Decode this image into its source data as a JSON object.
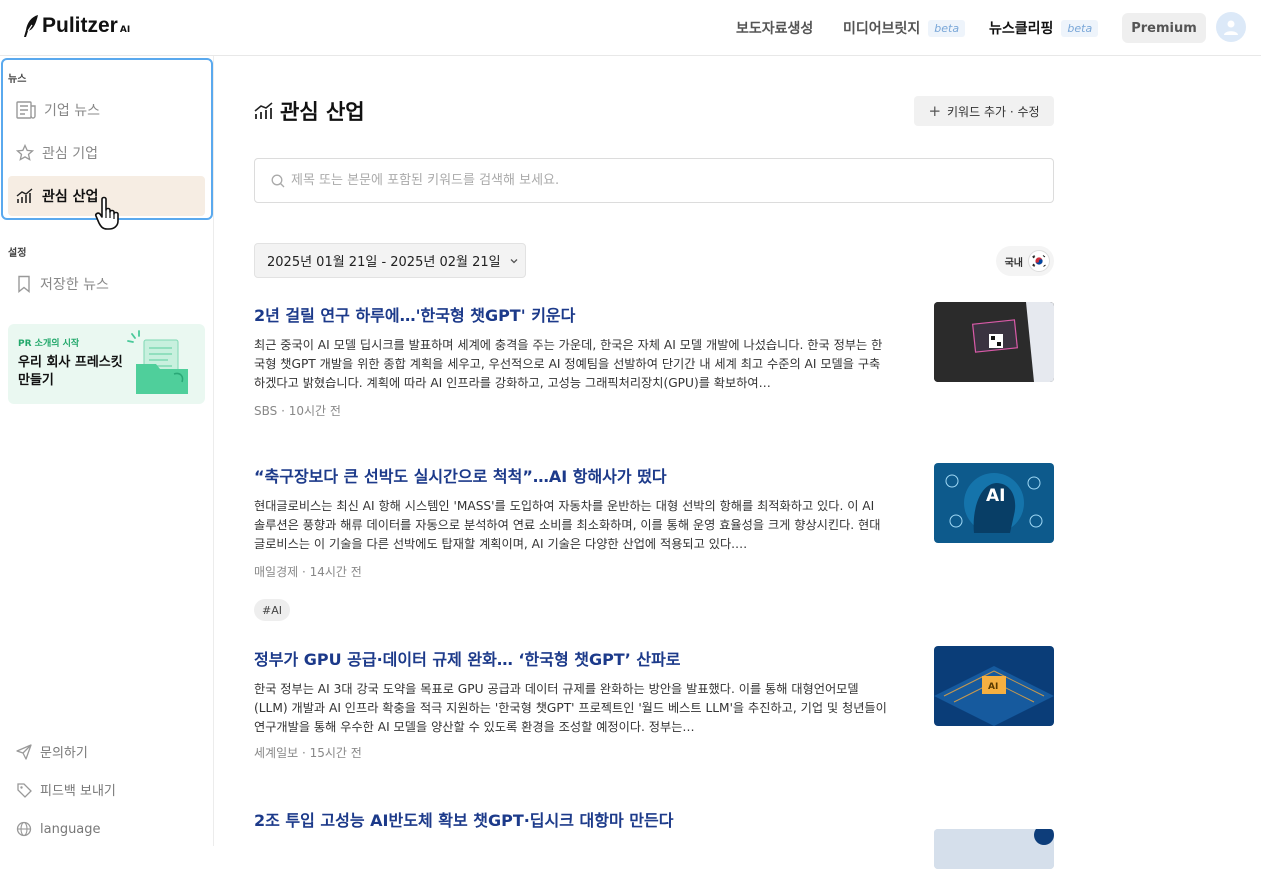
{
  "header": {
    "logo_name": "Pulitzer",
    "logo_suffix": "AI",
    "nav": [
      {
        "label": "보도자료생성",
        "badge": ""
      },
      {
        "label": "미디어브릿지",
        "badge": "beta"
      },
      {
        "label": "뉴스클리핑",
        "badge": "beta"
      }
    ],
    "premium_label": "Premium"
  },
  "sidebar": {
    "news_section": "뉴스",
    "items": [
      {
        "label": "기업 뉴스"
      },
      {
        "label": "관심 기업"
      },
      {
        "label": "관심 산업"
      }
    ],
    "settings_section": "설정",
    "saved_news": "저장한 뉴스",
    "promo": {
      "small": "PR 소개의 시작",
      "title": "우리 회사 프레스킷 만들기"
    },
    "bottom": [
      {
        "label": "문의하기"
      },
      {
        "label": "피드백 보내기"
      },
      {
        "label": "language"
      }
    ]
  },
  "main": {
    "title": "관심 산업",
    "keyword_button": "키워드 추가 · 수정",
    "search_placeholder": "제목 또는 본문에 포함된 키워드를 검색해 보세요.",
    "date_range": "2025년 01월 21일 - 2025년 02월 21일",
    "region": "국내",
    "articles": [
      {
        "title": "2년 걸릴 연구 하루에…'한국형 챗GPT' 키운다",
        "body": "최근 중국이 AI 모델 딥시크를 발표하며 세계에 충격을 주는 가운데, 한국은 자체 AI 모델 개발에 나섰습니다. 한국 정부는 한국형 챗GPT 개발을 위한 종합 계획을 세우고, 우선적으로 AI 정예팀을 선발하여 단기간 내 세계 최고 수준의 AI 모델을 구축하겠다고 밝혔습니다. 계획에 따라 AI 인프라를 강화하고, 고성능 그래픽처리장치(GPU)를 확보하여…",
        "meta": "SBS · 10시간 전",
        "tag": ""
      },
      {
        "title": "“축구장보다 큰 선박도 실시간으로 척척”…AI 항해사가 떴다",
        "body": "현대글로비스는 최신 AI 항해 시스템인 'MASS'를 도입하여 자동차를 운반하는 대형 선박의 항해를 최적화하고 있다. 이 AI 솔루션은 풍향과 해류 데이터를 자동으로 분석하여 연료 소비를 최소화하며, 이를 통해 운영 효율성을 크게 향상시킨다. 현대글로비스는 이 기술을 다른 선박에도 탑재할 계획이며, AI 기술은 다양한 산업에 적용되고 있다.…",
        "meta": "매일경제 · 14시간 전",
        "tag": "#AI"
      },
      {
        "title": "정부가 GPU 공급·데이터 규제 완화… ‘한국형 챗GPT’ 산파로",
        "body": "한국 정부는 AI 3대 강국 도약을 목표로 GPU 공급과 데이터 규제를 완화하는 방안을 발표했다. 이를 통해 대형언어모델(LLM) 개발과 AI 인프라 확충을 적극 지원하는 '한국형 챗GPT' 프로젝트인 '월드 베스트 LLM'을 추진하고, 기업 및 청년들이 연구개발을 통해 우수한 AI 모델을 양산할 수 있도록 환경을 조성할 예정이다. 정부는…",
        "meta": "세계일보 · 15시간 전",
        "tag": ""
      },
      {
        "title": "2조 투입 고성능 AI반도체 확보 챗GPT·딥시크 대항마 만든다",
        "body": "",
        "meta": "",
        "tag": ""
      }
    ]
  }
}
